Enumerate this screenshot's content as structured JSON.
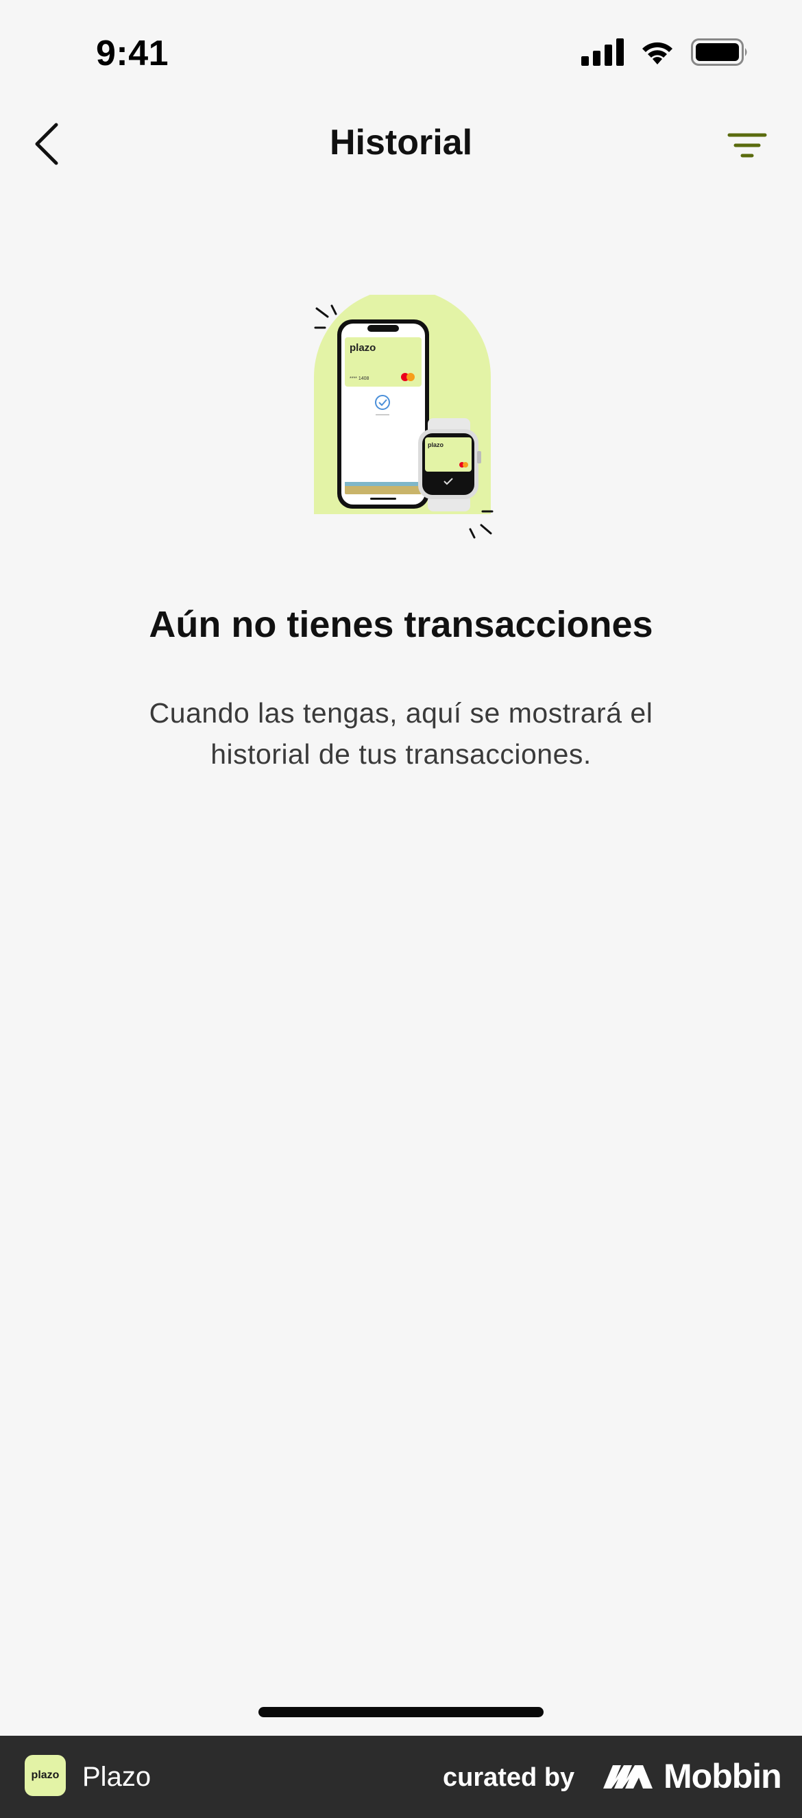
{
  "status_bar": {
    "time": "9:41",
    "icons": [
      "signal-icon",
      "wifi-icon",
      "battery-icon"
    ]
  },
  "nav": {
    "title": "Historial",
    "back_icon": "chevron-left-icon",
    "filter_icon": "filter-icon"
  },
  "illustration": {
    "card_brand": "plazo",
    "card_number": "**** 1408",
    "watch_brand": "plazo"
  },
  "empty_state": {
    "title": "Aún no tienes transacciones",
    "description": "Cuando las tengas, aquí se mostrará el historial de tus transacciones."
  },
  "footer": {
    "app_logo_text": "plazo",
    "app_name": "Plazo",
    "curated_by": "curated by",
    "brand": "Mobbin"
  },
  "colors": {
    "background": "#f6f6f6",
    "accent": "#5a6b0e",
    "illustration_bg": "#e3f3a6",
    "footer_bg": "#2c2c2c"
  }
}
